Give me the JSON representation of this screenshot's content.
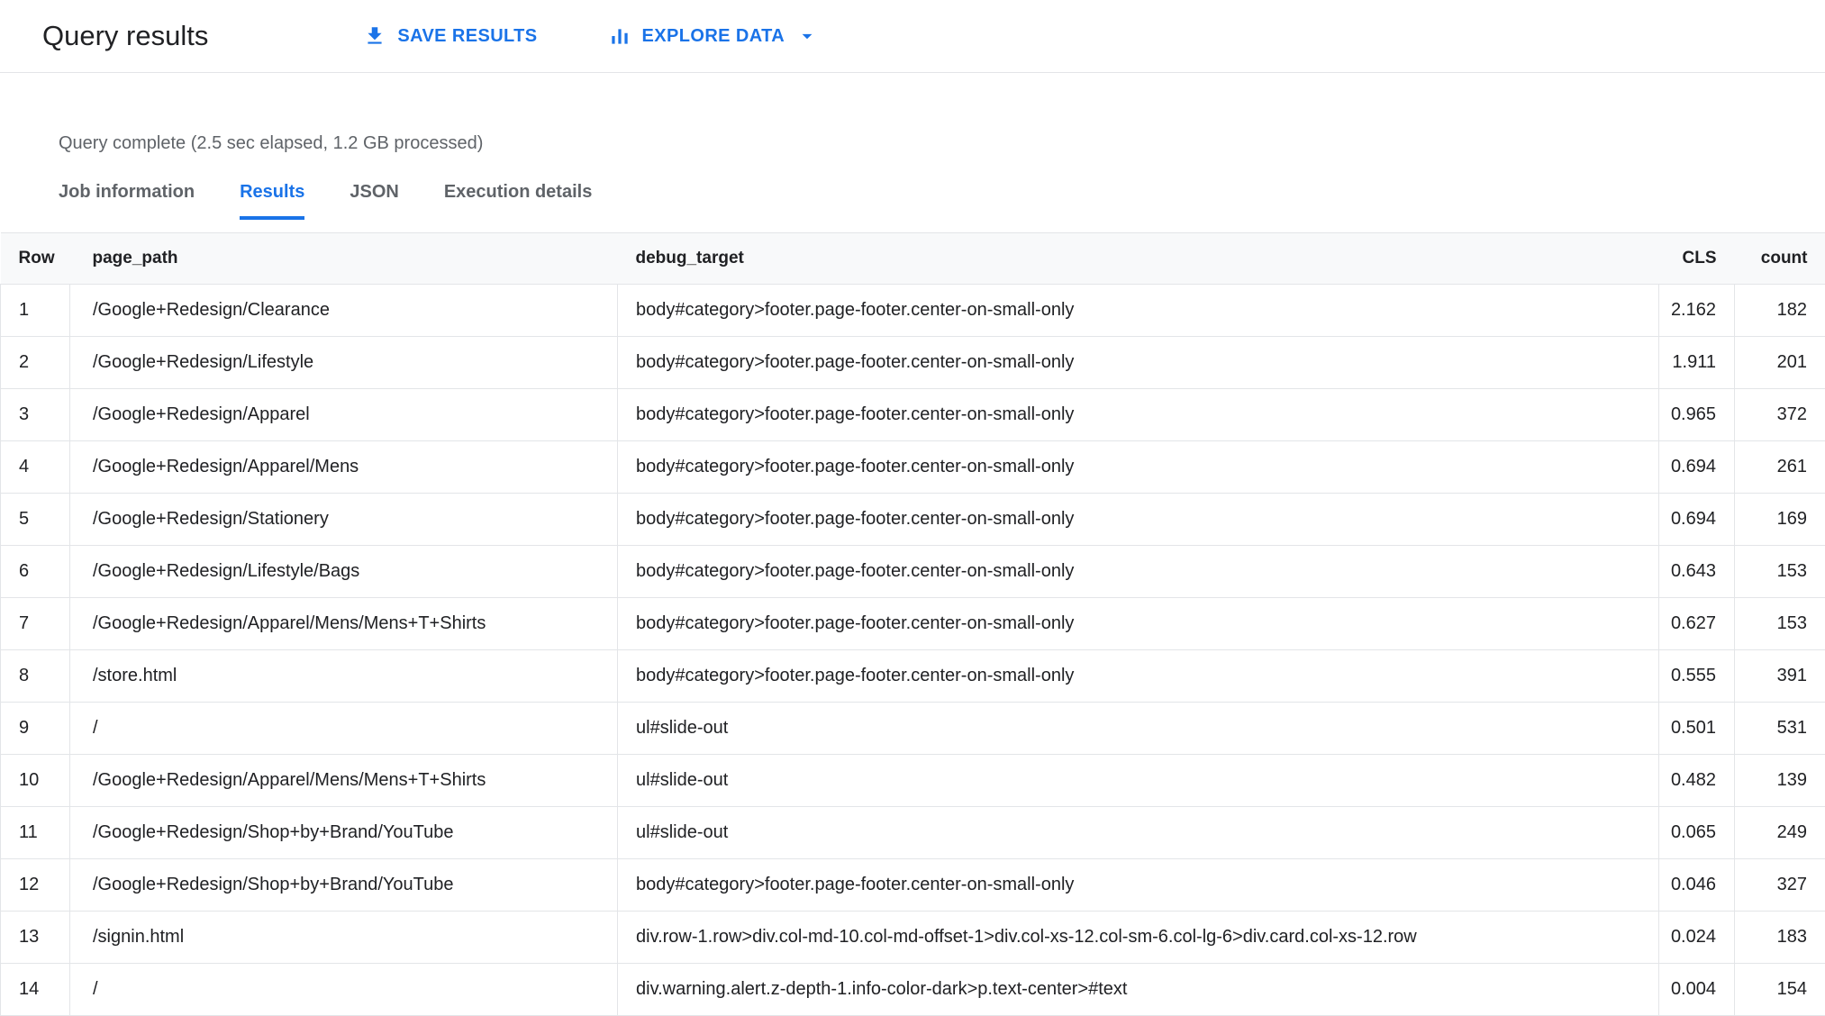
{
  "header": {
    "title": "Query results",
    "save_button": "SAVE RESULTS",
    "explore_button": "EXPLORE DATA"
  },
  "status": "Query complete (2.5 sec elapsed, 1.2 GB processed)",
  "tabs": [
    {
      "label": "Job information",
      "active": false
    },
    {
      "label": "Results",
      "active": true
    },
    {
      "label": "JSON",
      "active": false
    },
    {
      "label": "Execution details",
      "active": false
    }
  ],
  "colors": {
    "accent": "#1a73e8",
    "border": "#e3e5e8",
    "header_bg": "#f8f9fa"
  },
  "table": {
    "columns": [
      "Row",
      "page_path",
      "debug_target",
      "CLS",
      "count"
    ],
    "rows": [
      {
        "row": "1",
        "page_path": "/Google+Redesign/Clearance",
        "debug_target": "body#category>footer.page-footer.center-on-small-only",
        "cls": "2.162",
        "count": "182"
      },
      {
        "row": "2",
        "page_path": "/Google+Redesign/Lifestyle",
        "debug_target": "body#category>footer.page-footer.center-on-small-only",
        "cls": "1.911",
        "count": "201"
      },
      {
        "row": "3",
        "page_path": "/Google+Redesign/Apparel",
        "debug_target": "body#category>footer.page-footer.center-on-small-only",
        "cls": "0.965",
        "count": "372"
      },
      {
        "row": "4",
        "page_path": "/Google+Redesign/Apparel/Mens",
        "debug_target": "body#category>footer.page-footer.center-on-small-only",
        "cls": "0.694",
        "count": "261"
      },
      {
        "row": "5",
        "page_path": "/Google+Redesign/Stationery",
        "debug_target": "body#category>footer.page-footer.center-on-small-only",
        "cls": "0.694",
        "count": "169"
      },
      {
        "row": "6",
        "page_path": "/Google+Redesign/Lifestyle/Bags",
        "debug_target": "body#category>footer.page-footer.center-on-small-only",
        "cls": "0.643",
        "count": "153"
      },
      {
        "row": "7",
        "page_path": "/Google+Redesign/Apparel/Mens/Mens+T+Shirts",
        "debug_target": "body#category>footer.page-footer.center-on-small-only",
        "cls": "0.627",
        "count": "153"
      },
      {
        "row": "8",
        "page_path": "/store.html",
        "debug_target": "body#category>footer.page-footer.center-on-small-only",
        "cls": "0.555",
        "count": "391"
      },
      {
        "row": "9",
        "page_path": "/",
        "debug_target": "ul#slide-out",
        "cls": "0.501",
        "count": "531"
      },
      {
        "row": "10",
        "page_path": "/Google+Redesign/Apparel/Mens/Mens+T+Shirts",
        "debug_target": "ul#slide-out",
        "cls": "0.482",
        "count": "139"
      },
      {
        "row": "11",
        "page_path": "/Google+Redesign/Shop+by+Brand/YouTube",
        "debug_target": "ul#slide-out",
        "cls": "0.065",
        "count": "249"
      },
      {
        "row": "12",
        "page_path": "/Google+Redesign/Shop+by+Brand/YouTube",
        "debug_target": "body#category>footer.page-footer.center-on-small-only",
        "cls": "0.046",
        "count": "327"
      },
      {
        "row": "13",
        "page_path": "/signin.html",
        "debug_target": "div.row-1.row>div.col-md-10.col-md-offset-1>div.col-xs-12.col-sm-6.col-lg-6>div.card.col-xs-12.row",
        "cls": "0.024",
        "count": "183"
      },
      {
        "row": "14",
        "page_path": "/",
        "debug_target": "div.warning.alert.z-depth-1.info-color-dark>p.text-center>#text",
        "cls": "0.004",
        "count": "154"
      }
    ]
  }
}
